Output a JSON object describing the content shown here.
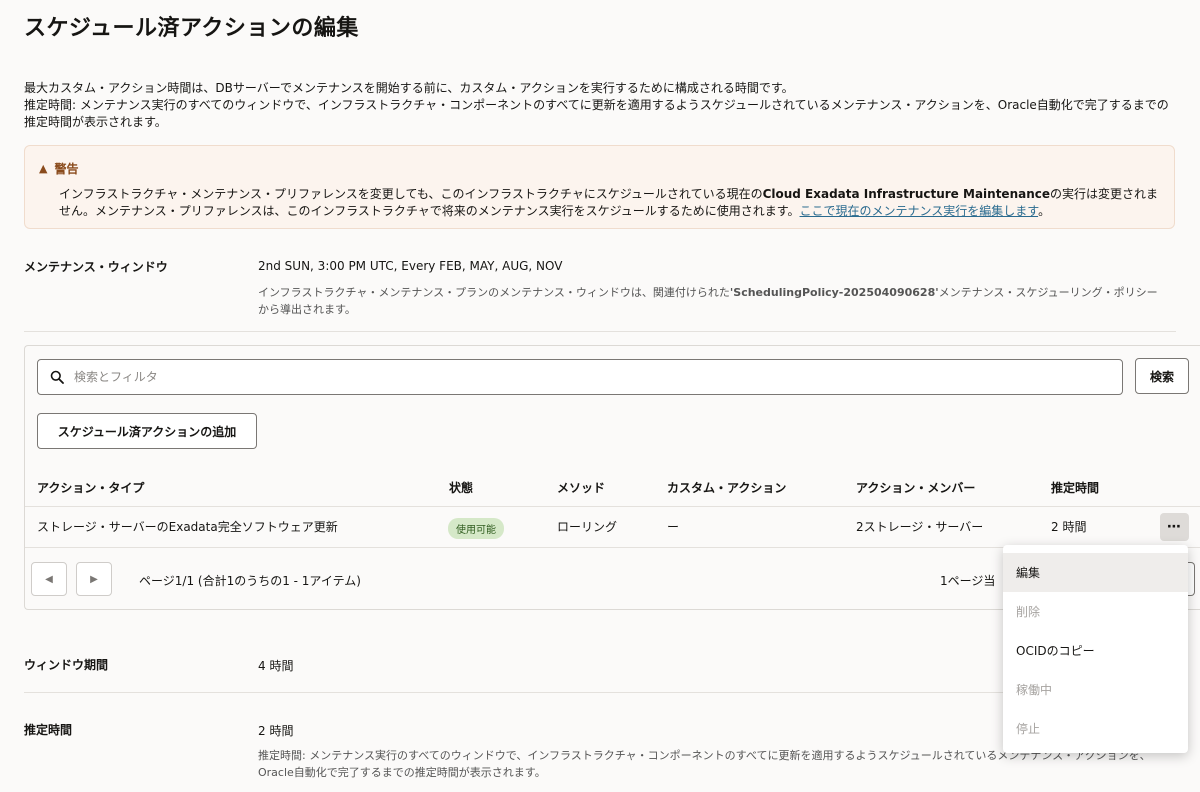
{
  "page": {
    "title": "スケジュール済アクションの編集"
  },
  "description": {
    "line1": "最大カスタム・アクション時間は、DBサーバーでメンテナンスを開始する前に、カスタム・アクションを実行するために構成される時間です。",
    "line2": "推定時間: メンテナンス実行のすべてのウィンドウで、インフラストラクチャ・コンポーネントのすべてに更新を適用するようスケジュールされているメンテナンス・アクションを、Oracle自動化で完了するまでの推定時間が表示されます。"
  },
  "warning": {
    "title": "警告",
    "text_before": "インフラストラクチャ・メンテナンス・プリファレンスを変更しても、このインフラストラクチャにスケジュールされている現在の",
    "text_bold": "Cloud Exadata Infrastructure Maintenance",
    "text_after": "の実行は変更されません。メンテナンス・プリファレンスは、このインフラストラクチャで将来のメンテナンス実行をスケジュールするために使用されます。",
    "link_text": "ここで現在のメンテナンス実行を編集します",
    "text_end": "。"
  },
  "maintenance_window": {
    "label": "メンテナンス・ウィンドウ",
    "value": "2nd SUN, 3:00 PM UTC, Every FEB, MAY, AUG, NOV",
    "sub_before": "インフラストラクチャ・メンテナンス・プランのメンテナンス・ウィンドウは、関連付けられた",
    "sub_bold": "'SchedulingPolicy-202504090628'",
    "sub_after": "メンテナンス・スケジューリング・ポリシーから導出されます。"
  },
  "search": {
    "placeholder": "検索とフィルタ",
    "button_label": "検索"
  },
  "add_button_label": "スケジュール済アクションの追加",
  "table": {
    "headers": [
      "アクション・タイプ",
      "状態",
      "メソッド",
      "カスタム・アクション",
      "アクション・メンバー",
      "推定時間"
    ],
    "rows": [
      {
        "action_type": "ストレージ・サーバーのExadata完全ソフトウェア更新",
        "status": "使用可能",
        "method": "ローリング",
        "custom_action": "ー",
        "members": "2ストレージ・サーバー",
        "estimated_time": "2 時間",
        "actions_icon": "⋯"
      }
    ]
  },
  "pagination": {
    "prev_icon": "◀",
    "next_icon": "▶",
    "info": "ページ1/1 (合計1のうちの1 - 1アイテム)",
    "per_page_label": "1ページ当"
  },
  "context_menu": {
    "items": [
      {
        "label": "編集",
        "state": "active"
      },
      {
        "label": "削除",
        "state": "disabled"
      },
      {
        "label": "OCIDのコピー",
        "state": "enabled"
      },
      {
        "label": "稼働中",
        "state": "disabled"
      },
      {
        "label": "停止",
        "state": "disabled"
      }
    ]
  },
  "window_duration": {
    "label": "ウィンドウ期間",
    "value": "4 時間"
  },
  "estimated": {
    "label": "推定時間",
    "value": "2 時間",
    "sub": "推定時間: メンテナンス実行のすべてのウィンドウで、インフラストラクチャ・コンポーネントのすべてに更新を適用するようスケジュールされているメンテナンス・アクションを、Oracle自動化で完了するまでの推定時間が表示されます。"
  }
}
